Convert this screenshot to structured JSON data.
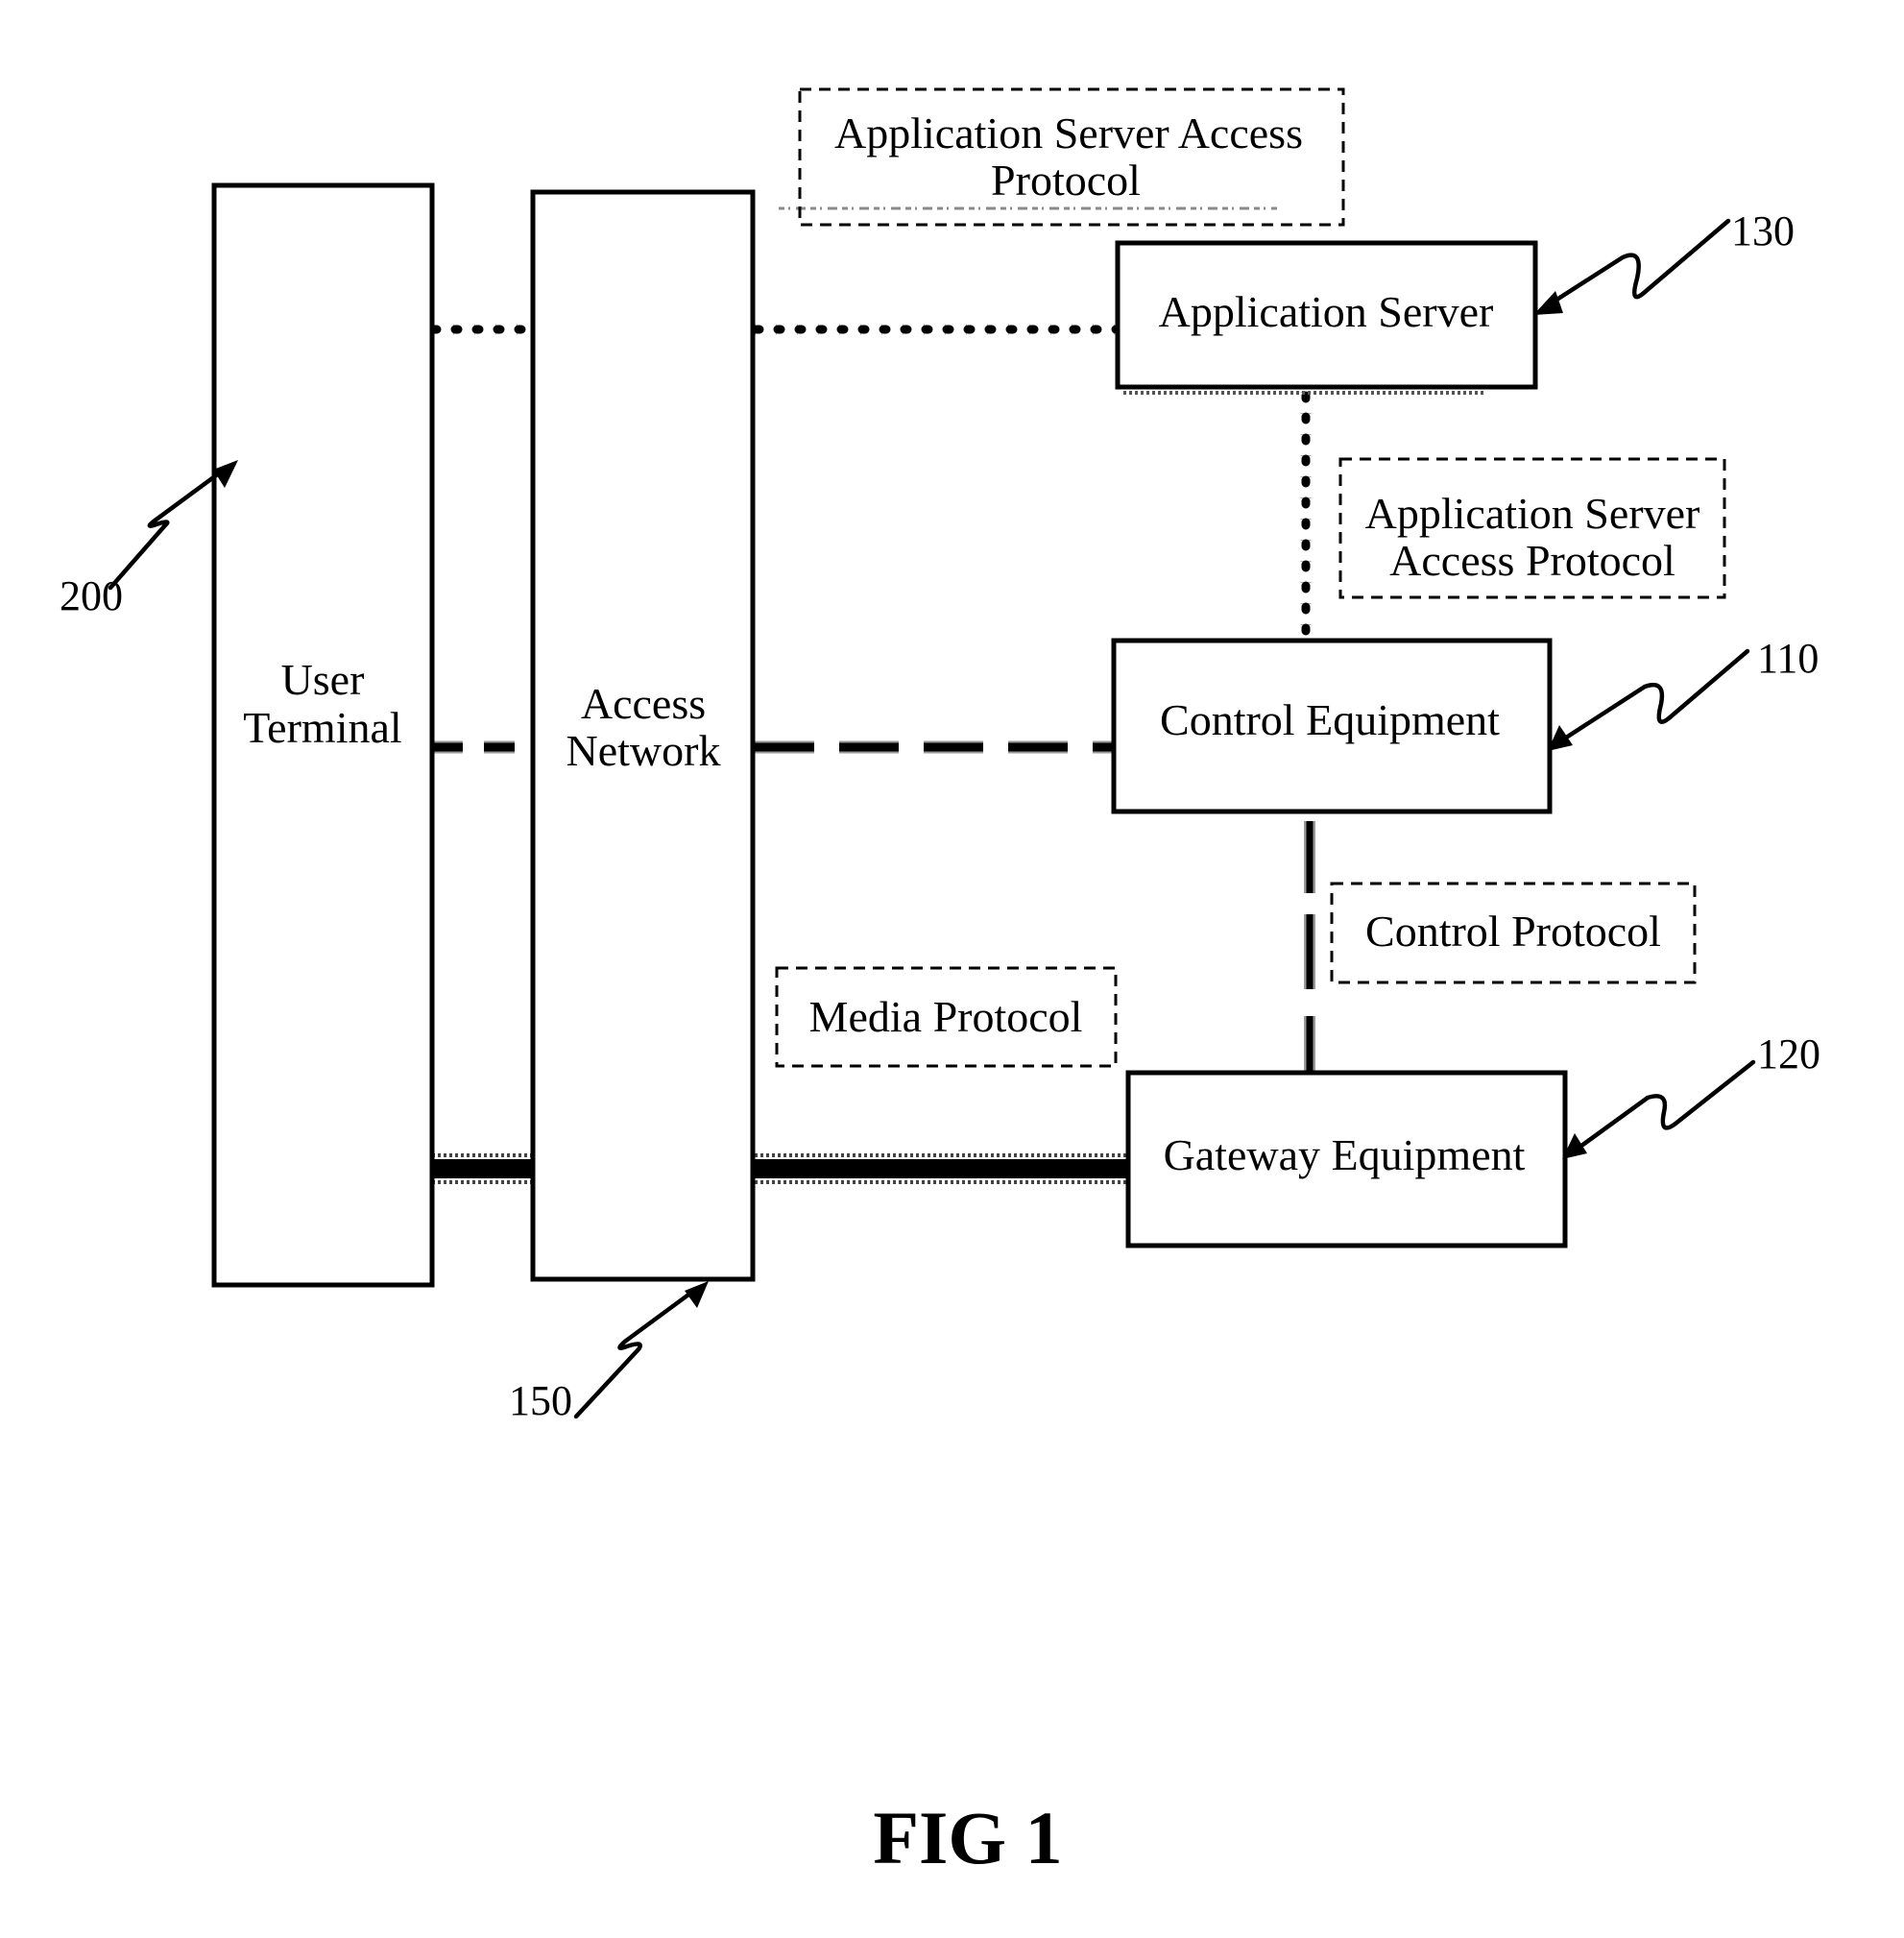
{
  "figure": {
    "caption": "FIG 1"
  },
  "nodes": {
    "user_terminal": {
      "label_lines": [
        "User",
        "Terminal"
      ],
      "ref": "200"
    },
    "access_network": {
      "label_lines": [
        "Access",
        "Network"
      ],
      "ref": "150"
    },
    "application_server": {
      "label": "Application Server",
      "ref": "130"
    },
    "control_equipment": {
      "label": "Control Equipment",
      "ref": "110"
    },
    "gateway_equipment": {
      "label": "Gateway Equipment",
      "ref": "120"
    }
  },
  "protocol_labels": {
    "top_as_access": {
      "lines": [
        "Application Server Access",
        "Protocol"
      ]
    },
    "side_as_access": {
      "lines": [
        "Application Server",
        "Access Protocol"
      ]
    },
    "control": {
      "label": "Control Protocol"
    },
    "media": {
      "label": "Media Protocol"
    }
  },
  "connections": [
    {
      "from": "user_terminal",
      "to": "application_server",
      "via": "access_network",
      "style": "dotted",
      "protocol": "Application Server Access Protocol"
    },
    {
      "from": "application_server",
      "to": "control_equipment",
      "style": "dotted",
      "protocol": "Application Server Access Protocol"
    },
    {
      "from": "user_terminal",
      "to": "control_equipment",
      "via": "access_network",
      "style": "dashed",
      "protocol": "Control Protocol"
    },
    {
      "from": "control_equipment",
      "to": "gateway_equipment",
      "style": "dashed",
      "protocol": "Control Protocol"
    },
    {
      "from": "user_terminal",
      "to": "gateway_equipment",
      "via": "access_network",
      "style": "thick-solid",
      "protocol": "Media Protocol"
    }
  ]
}
